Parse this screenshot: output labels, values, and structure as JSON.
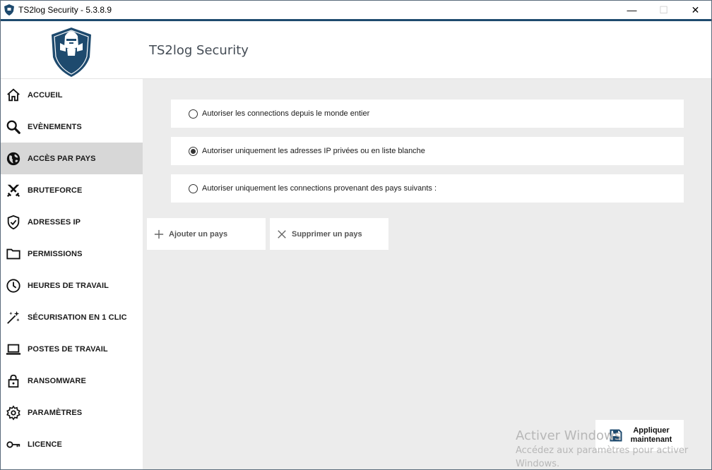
{
  "window": {
    "title": "TS2log Security - 5.3.8.9",
    "controls": {
      "minimize": "—",
      "maximize": "☐",
      "close": "✕"
    }
  },
  "header": {
    "title": "TS2log Security"
  },
  "colors": {
    "accent": "#1e4a6e",
    "active_nav": "#d7d7d7",
    "content_bg": "#ececec"
  },
  "sidebar": {
    "items": [
      {
        "label": "ACCUEIL",
        "icon": "home-icon"
      },
      {
        "label": "EVÈNEMENTS",
        "icon": "search-icon"
      },
      {
        "label": "ACCÈS PAR PAYS",
        "icon": "globe-icon",
        "active": true
      },
      {
        "label": "BRUTEFORCE",
        "icon": "crossed-swords-icon"
      },
      {
        "label": "ADRESSES IP",
        "icon": "shield-check-icon"
      },
      {
        "label": "PERMISSIONS",
        "icon": "folder-icon"
      },
      {
        "label": "HEURES DE TRAVAIL",
        "icon": "clock-icon"
      },
      {
        "label": "SÉCURISATION EN 1 CLIC",
        "icon": "magic-wand-icon"
      },
      {
        "label": "POSTES DE TRAVAIL",
        "icon": "laptop-icon"
      },
      {
        "label": "RANSOMWARE",
        "icon": "lock-icon"
      },
      {
        "label": "PARAMÈTRES",
        "icon": "gear-icon"
      },
      {
        "label": "LICENCE",
        "icon": "key-icon"
      }
    ]
  },
  "main": {
    "options": [
      {
        "label": "Autoriser les connections depuis le monde entier",
        "checked": false
      },
      {
        "label": "Autoriser uniquement les adresses IP privées ou en liste blanche",
        "checked": true
      },
      {
        "label": "Autoriser uniquement les connections provenant des pays suivants :",
        "checked": false
      }
    ],
    "add_country_label": "Ajouter un pays",
    "remove_country_label": "Supprimer un pays",
    "apply_label": "Appliquer\nmaintenant"
  },
  "watermark": {
    "title": "Activer Windows",
    "subtitle": "Accédez aux paramètres pour activer Windows."
  }
}
